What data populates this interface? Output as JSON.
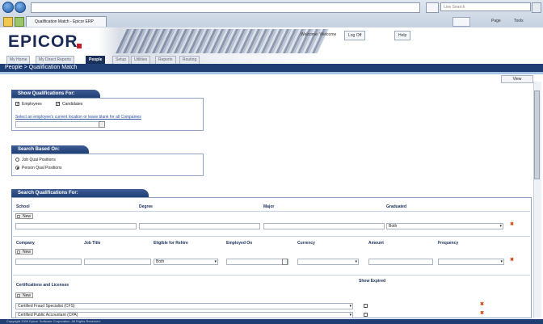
{
  "browser": {
    "tab_title": "Qualification Match - Epicor ERP",
    "search_placeholder": "Live Search",
    "cmd_page": "Page",
    "cmd_tools": "Tools"
  },
  "app": {
    "logo": "EPICOR",
    "welcome": "Welcome: Welcome",
    "logoff": "Log Off",
    "help": "Help",
    "nav_tabs": [
      "My Home",
      "My Direct Reports",
      "People",
      "Setup",
      "Utilities",
      "Reports",
      "Routing"
    ],
    "active_tab": "People",
    "breadcrumb": "People > Qualification Match",
    "view_button": "View"
  },
  "show_for": {
    "title": "Show Qualifications For:",
    "employees": "Employees",
    "candidates": "Candidates",
    "link": "Select an employee's current location or leave blank for all Companies"
  },
  "search_based": {
    "title": "Search Based On:",
    "opt1": "Job Qual Positions",
    "opt2": "Person Qual Positions",
    "selected": "Person Qual Positions"
  },
  "search_quals": {
    "title": "Search Qualifications For:",
    "edu_headers": [
      "School",
      "Degree",
      "Major",
      "Graduated"
    ],
    "graduated_value": "Both",
    "new_label": "New",
    "emp_headers": [
      "Company",
      "Job Title",
      "Eligible for Rehire",
      "Employed On",
      "Currency",
      "Amount",
      "Frequency"
    ],
    "rehire_value": "Both",
    "cert_header": "Certifications and Licenses",
    "show_expired": "Show Expired",
    "certs": [
      "Certified Fraud Specialist (CFS)",
      "Certified Public Accountant (CPA)"
    ]
  },
  "status": "Copyright 2009 Epicor Software Corporation. All Rights Reserved."
}
